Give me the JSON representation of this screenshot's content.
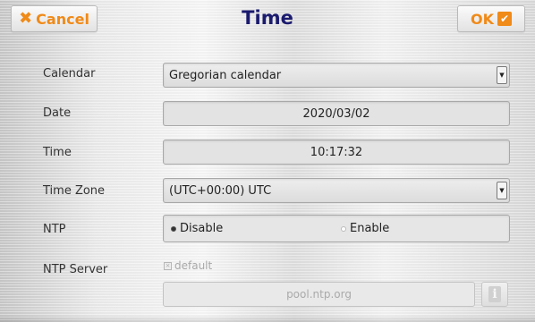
{
  "header": {
    "cancel_label": "Cancel",
    "title": "Time",
    "ok_label": "OK"
  },
  "form": {
    "calendar": {
      "label": "Calendar",
      "value": "Gregorian calendar"
    },
    "date": {
      "label": "Date",
      "value": "2020/03/02"
    },
    "time": {
      "label": "Time",
      "value": "10:17:32"
    },
    "timezone": {
      "label": "Time Zone",
      "value": "(UTC+00:00) UTC"
    },
    "ntp": {
      "label": "NTP",
      "options": [
        {
          "label": "Disable",
          "selected": true
        },
        {
          "label": "Enable",
          "selected": false
        }
      ]
    },
    "ntp_server": {
      "label": "NTP Server",
      "default_label": "default",
      "default_checked": false,
      "value": "pool.ntp.org"
    }
  },
  "colors": {
    "accent": "#f08a18",
    "title": "#1a1a6e"
  },
  "icons": {
    "cancel": "close-icon",
    "ok": "checkmark-icon",
    "info": "info-icon",
    "dropdown": "dropdown-arrow-icon"
  }
}
